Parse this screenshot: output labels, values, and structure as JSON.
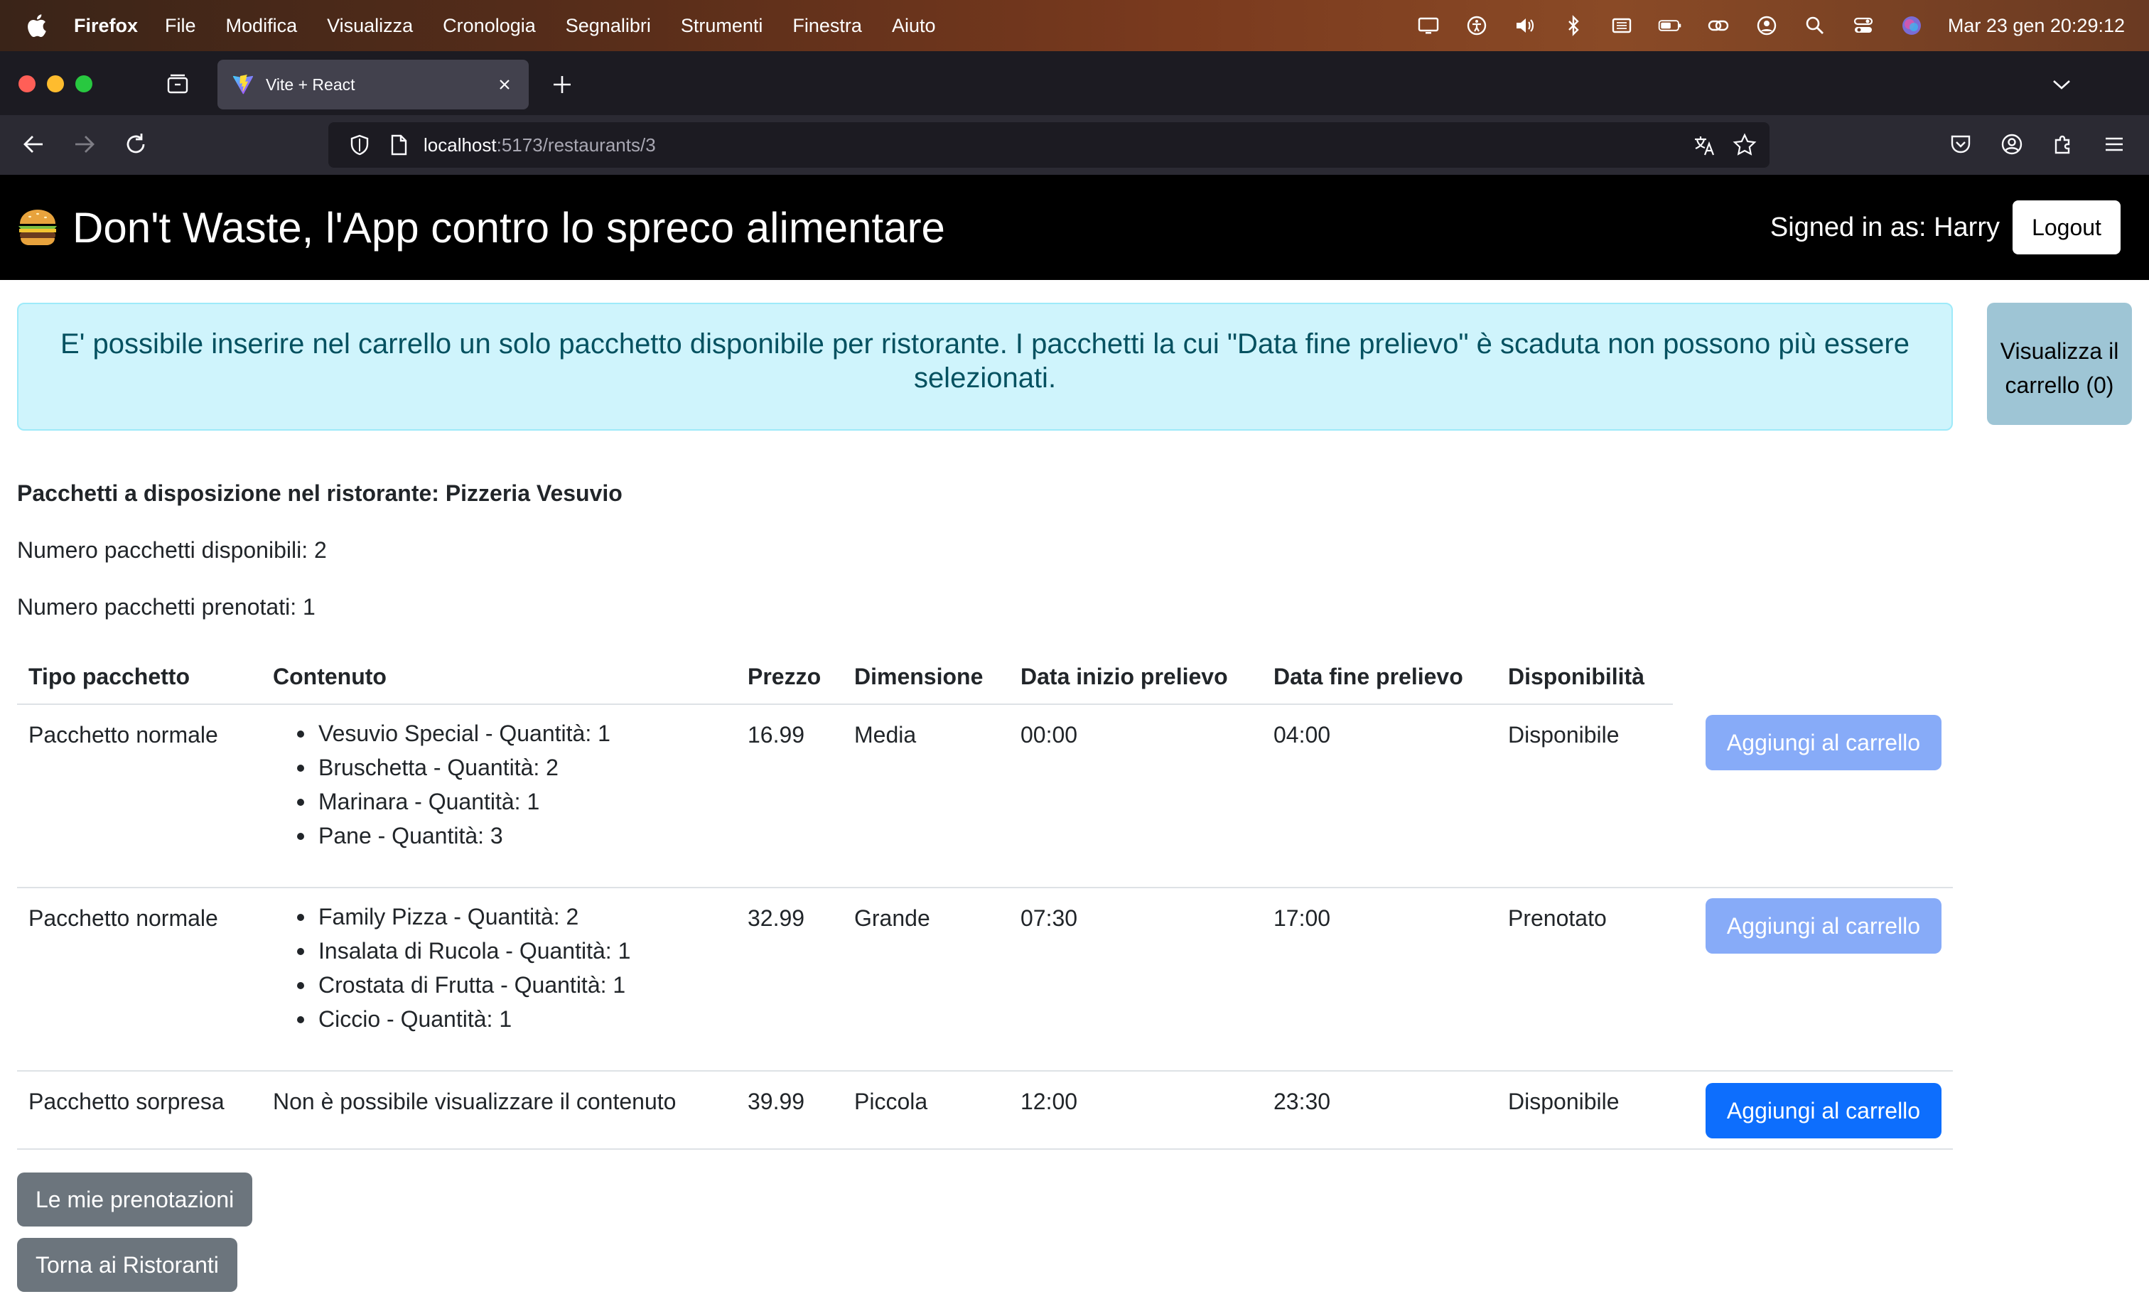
{
  "menubar": {
    "app_name": "Firefox",
    "items": [
      "File",
      "Modifica",
      "Visualizza",
      "Cronologia",
      "Segnalibri",
      "Strumenti",
      "Finestra",
      "Aiuto"
    ],
    "clock": "Mar 23 gen  20:29:12"
  },
  "browser": {
    "tab_title": "Vite + React",
    "url_host": "localhost",
    "url_path": ":5173/restaurants/3"
  },
  "app": {
    "brand": "Don't Waste, l'App contro lo spreco alimentare",
    "signed_in": "Signed in as: Harry",
    "logout_label": "Logout"
  },
  "alert": {
    "text": "E' possibile inserire nel carrello un solo pacchetto disponibile per ristorante. I pacchetti la cui \"Data fine prelievo\" è scaduta non possono più essere selezionati."
  },
  "cart": {
    "label": "Visualizza il carrello (0)"
  },
  "summary": {
    "restaurant": "Pacchetti a disposizione nel ristorante: Pizzeria Vesuvio",
    "available": "Numero pacchetti disponibili: 2",
    "booked": "Numero pacchetti prenotati: 1"
  },
  "table": {
    "headers": [
      "Tipo pacchetto",
      "Contenuto",
      "Prezzo",
      "Dimensione",
      "Data inizio prelievo",
      "Data fine prelievo",
      "Disponibilità"
    ],
    "rows": [
      {
        "type": "Pacchetto normale",
        "contents": [
          "Vesuvio Special - Quantità: 1",
          "Bruschetta - Quantità: 2",
          "Marinara - Quantità: 1",
          "Pane - Quantità: 3"
        ],
        "price": "16.99",
        "size": "Media",
        "start": "00:00",
        "end": "04:00",
        "availability": "Disponibile",
        "button": "Aggiungi al carrello",
        "button_enabled": false
      },
      {
        "type": "Pacchetto normale",
        "contents": [
          "Family Pizza - Quantità: 2",
          "Insalata di Rucola - Quantità: 1",
          "Crostata di Frutta - Quantità: 1",
          "Ciccio - Quantità: 1"
        ],
        "price": "32.99",
        "size": "Grande",
        "start": "07:30",
        "end": "17:00",
        "availability": "Prenotato",
        "button": "Aggiungi al carrello",
        "button_enabled": false
      },
      {
        "type": "Pacchetto sorpresa",
        "contents_text": "Non è possibile visualizzare il contenuto",
        "price": "39.99",
        "size": "Piccola",
        "start": "12:00",
        "end": "23:30",
        "availability": "Disponibile",
        "button": "Aggiungi al carrello",
        "button_enabled": true
      }
    ]
  },
  "footer_buttons": {
    "bookings": "Le mie prenotazioni",
    "back": "Torna ai Ristoranti"
  },
  "colors": {
    "primary": "#0d6efd",
    "primary_disabled": "#87abf8",
    "secondary": "#6c757d",
    "alert_bg": "#cff4fc",
    "alert_text": "#055160"
  }
}
